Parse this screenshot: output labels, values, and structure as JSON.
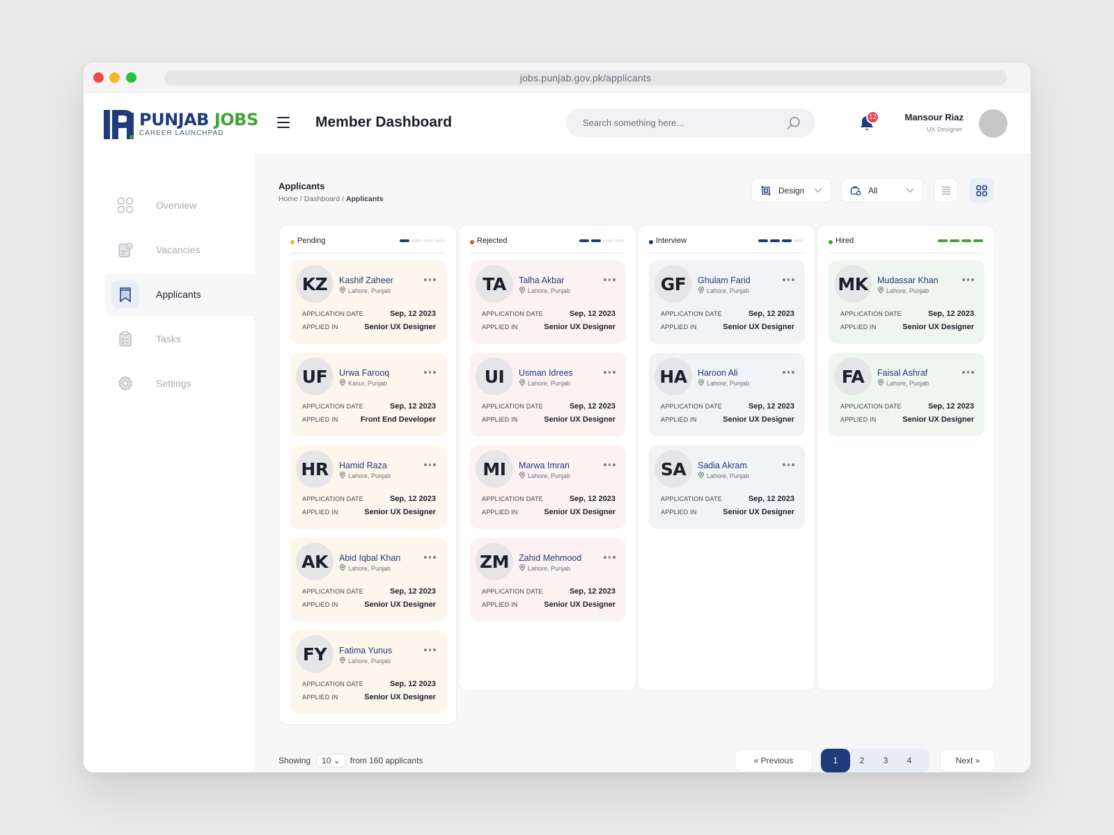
{
  "browser": {
    "url": "jobs.punjab.gov.pk/applicants"
  },
  "brand": {
    "word1": "PUNJAB",
    "word2": "JOBS",
    "tagline": "CAREER LAUNCHPAD",
    "colors": {
      "navy": "#1f3b7a",
      "green": "#3fa535"
    }
  },
  "header": {
    "title": "Member Dashboard",
    "search_placeholder": "Search something here...",
    "notification_count": "12",
    "user": {
      "name": "Mansour Riaz",
      "role": "UX Designer"
    }
  },
  "sidebar": {
    "items": [
      {
        "label": "Overview",
        "icon": "grid-icon",
        "active": false
      },
      {
        "label": "Vacancies",
        "icon": "clipboard-check-icon",
        "active": false
      },
      {
        "label": "Applicants",
        "icon": "bookmark-icon",
        "active": true
      },
      {
        "label": "Tasks",
        "icon": "task-list-icon",
        "active": false
      },
      {
        "label": "Settings",
        "icon": "gear-icon",
        "active": false
      }
    ]
  },
  "section": {
    "title": "Applicants",
    "breadcrumb": {
      "home": "Home",
      "dashboard": "Dashboard",
      "current": "Applicants",
      "sep": " / "
    },
    "filters": {
      "category": "Design",
      "status": "All"
    },
    "view_modes": [
      "list",
      "grid"
    ],
    "active_view": "grid"
  },
  "card_labels": {
    "date_label": "APPLICATION DATE",
    "applied_label": "APPLIED IN"
  },
  "columns": [
    {
      "title": "Pending",
      "dot_color": "#f2b720",
      "stage": 1,
      "bar_color": "#1f3b7a",
      "cards": [
        {
          "initials": "KZ",
          "name": "Kashif Zaheer",
          "location": "Lahore, Punjab",
          "date": "Sep, 12 2023",
          "role": "Senior UX Designer"
        },
        {
          "initials": "UF",
          "name": "Urwa Farooq",
          "location": "Kasur, Punjab",
          "date": "Sep, 12 2023",
          "role": "Front End Developer"
        },
        {
          "initials": "HR",
          "name": "Hamid Raza",
          "location": "Lahore, Punjab",
          "date": "Sep, 12 2023",
          "role": "Senior UX Designer"
        },
        {
          "initials": "AK",
          "name": "Abid Iqbal Khan",
          "location": "Lahore, Punjab",
          "date": "Sep, 12 2023",
          "role": "Senior UX Designer"
        },
        {
          "initials": "FY",
          "name": "Fatima Yunus",
          "location": "Lahore, Punjab",
          "date": "Sep, 12 2023",
          "role": "Senior UX Designer"
        }
      ]
    },
    {
      "title": "Rejected",
      "dot_color": "#e2434b",
      "stage": 2,
      "bar_color": "#1f3b7a",
      "cards": [
        {
          "initials": "TA",
          "name": "Talha Akbar",
          "location": "Lahore, Punjab",
          "date": "Sep, 12 2023",
          "role": "Senior UX Designer"
        },
        {
          "initials": "UI",
          "name": "Usman Idrees",
          "location": "Lahore, Punjab",
          "date": "Sep, 12 2023",
          "role": "Senior UX Designer"
        },
        {
          "initials": "MI",
          "name": "Marwa Imran",
          "location": "Lahore, Punjab",
          "date": "Sep, 12 2023",
          "role": "Senior UX Designer"
        },
        {
          "initials": "ZM",
          "name": "Zahid Mehmood",
          "location": "Lahore, Punjab",
          "date": "Sep, 12 2023",
          "role": "Senior UX Designer"
        }
      ]
    },
    {
      "title": "Interview",
      "dot_color": "#1f3b7a",
      "stage": 3,
      "bar_color": "#1f3b7a",
      "cards": [
        {
          "initials": "GF",
          "name": "Ghulam Farid",
          "location": "Lahore, Punjab",
          "date": "Sep, 12 2023",
          "role": "Senior UX Designer"
        },
        {
          "initials": "HA",
          "name": "Haroon Ali",
          "location": "Lahore, Punjab",
          "date": "Sep, 12 2023",
          "role": "Senior UX Designer"
        },
        {
          "initials": "SA",
          "name": "Sadia Akram",
          "location": "Lahore, Punjab",
          "date": "Sep, 12 2023",
          "role": "Senior UX Designer"
        }
      ]
    },
    {
      "title": "Hired",
      "dot_color": "#3fa535",
      "stage": 4,
      "bar_color": "#3fa535",
      "cards": [
        {
          "initials": "MK",
          "name": "Mudassar Khan",
          "location": "Lahore, Punjab",
          "date": "Sep, 12 2023",
          "role": "Senior UX Designer"
        },
        {
          "initials": "FA",
          "name": "Faisal Ashraf",
          "location": "Lahore, Punjab",
          "date": "Sep, 12 2023",
          "role": "Senior UX Designer"
        }
      ]
    }
  ],
  "card_bg": [
    "#fdf6ec",
    "#fdf2f2",
    "#f2f3f6",
    "#eef6ef"
  ],
  "footer": {
    "showing_label": "Showing",
    "per_page": "10",
    "from_label": "from 160 applicants",
    "prev_label": "Previous",
    "next_label": "Next",
    "pages": [
      "1",
      "2",
      "3",
      "4"
    ],
    "current_page": "1"
  }
}
